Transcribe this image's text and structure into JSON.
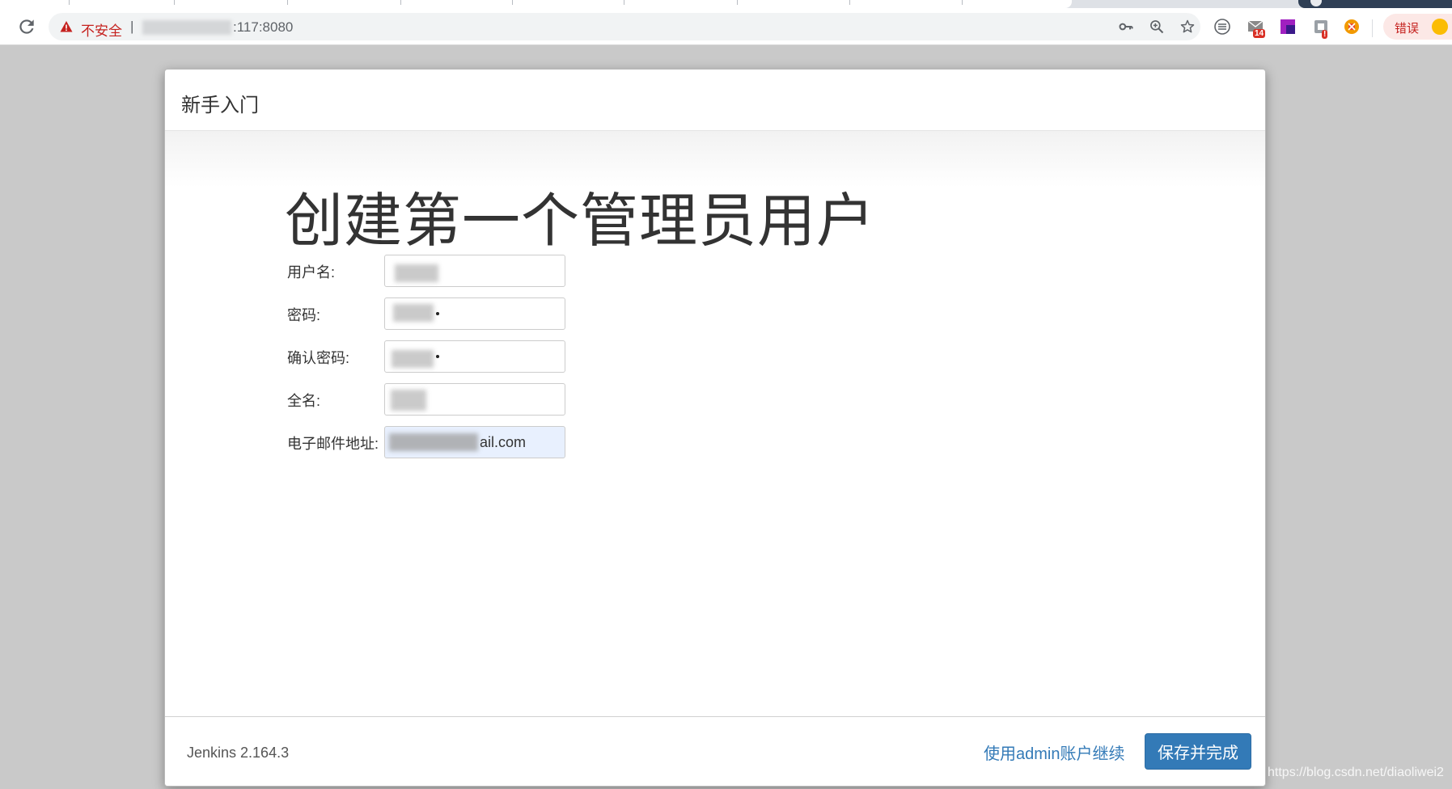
{
  "browser": {
    "security_label": "不安全",
    "separator": "|",
    "url": ":117:8080",
    "mail_badge": "14",
    "ext_badge": "!",
    "error_label": "错误"
  },
  "dialog": {
    "header_title": "新手入门",
    "page_heading": "创建第一个管理员用户",
    "fields": [
      {
        "label": "用户名:",
        "value": ""
      },
      {
        "label": "密码:",
        "value": ""
      },
      {
        "label": "确认密码:",
        "value": ""
      },
      {
        "label": "全名:",
        "value": ""
      },
      {
        "label": "电子邮件地址:",
        "value": "ail.com"
      }
    ],
    "footer": {
      "version": "Jenkins 2.164.3",
      "continue_admin_link": "使用admin账户继续",
      "save_button": "保存并完成"
    }
  },
  "watermark": "https://blog.csdn.net/diaoliwei2",
  "colors": {
    "primary": "#337ab7",
    "warning": "#c5221f",
    "autofill": "#e8f0fe"
  },
  "icons": [
    "reload-icon",
    "warning-icon",
    "key-icon",
    "zoom-icon",
    "star-icon",
    "reader-icon",
    "mail-icon",
    "rp-icon",
    "puzzle-icon",
    "chrome-ext-icon",
    "emoji-icon"
  ]
}
